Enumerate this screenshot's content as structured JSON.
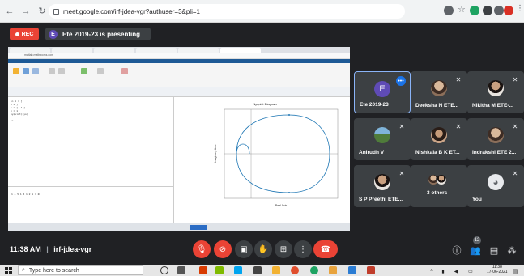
{
  "browser": {
    "url": "meet.google.com/irf-jdea-vgr?authuser=3&pli=1",
    "back_icon": "back-arrow-icon",
    "forward_icon": "forward-arrow-icon",
    "reload_icon": "reload-icon"
  },
  "meet": {
    "rec_label": "REC",
    "presenter_initial": "E",
    "presenting_text": "Ete 2019-23 is presenting",
    "time": "11:38 AM",
    "separator": "|",
    "meeting_code": "irf-jdea-vgr",
    "participant_count": "12"
  },
  "presentation": {
    "tabs": [
      "",
      "",
      "",
      "",
      "",
      "",
      ""
    ],
    "url": "matlab.mathworks.com",
    "command_lines": [
      ">> z = [",
      "  1 0 ]",
      "  p = [ -1 ]",
      "  k = 1",
      "  nyquist(sys)",
      "",
      ">>"
    ],
    "figure_title": "Nyquist Diagram",
    "figure_xlabel": "Real Axis",
    "figure_ylabel": "Imaginary Axis",
    "bottom_text": "1 4 5 1 5 1 2 1 = 20"
  },
  "tiles": [
    {
      "name": "Ete 2019-23",
      "avatar": "E"
    },
    {
      "name": "Deeksha N ETE..."
    },
    {
      "name": "Nikitha M ETE-..."
    },
    {
      "name": "Anirudh V"
    },
    {
      "name": "Nishkala B K ET..."
    },
    {
      "name": "Indrakshi ETE 2..."
    },
    {
      "name": "S P Preethi ETE..."
    },
    {
      "name": "3 others"
    },
    {
      "name": "You"
    }
  ],
  "controls": {
    "mic_icon": "mic-off-icon",
    "cam_icon": "camera-off-icon",
    "cc_icon": "captions-icon",
    "hand_icon": "raise-hand-icon",
    "present_icon": "present-screen-icon",
    "more_icon": "more-options-icon",
    "end_icon": "end-call-icon",
    "info_icon": "info-icon",
    "people_icon": "people-icon",
    "chat_icon": "chat-icon",
    "activities_icon": "activities-icon"
  },
  "taskbar": {
    "search_placeholder": "Type here to search",
    "clock_time": "11:38",
    "clock_date": "17-06-2021"
  }
}
